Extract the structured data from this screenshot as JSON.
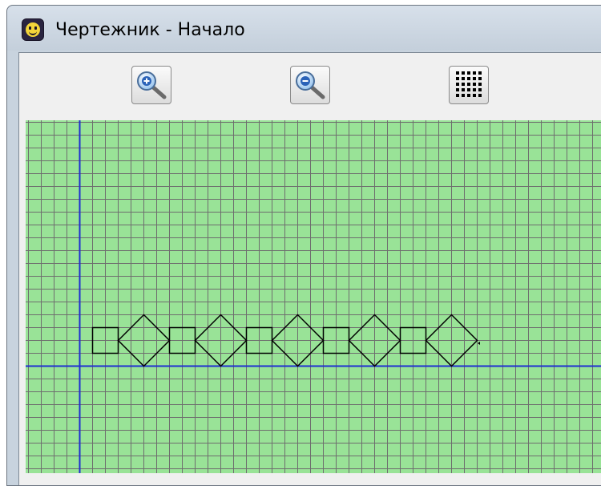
{
  "window": {
    "title": "Чертежник - Начало"
  },
  "toolbar": {
    "buttons": [
      {
        "name": "zoom-in-button",
        "icon": "magnifier-plus-icon"
      },
      {
        "name": "zoom-out-button",
        "icon": "magnifier-minus-icon"
      },
      {
        "name": "grid-toggle-button",
        "icon": "grid-dots-icon"
      }
    ]
  },
  "canvas": {
    "background_color": "#99e397",
    "grid_color": "#6e6e6e",
    "axis_color": "#1f2fd1",
    "pen_color": "#000000",
    "pattern": [
      "square",
      "diamond",
      "square",
      "diamond",
      "square",
      "diamond",
      "square",
      "diamond",
      "square",
      "diamond"
    ]
  }
}
